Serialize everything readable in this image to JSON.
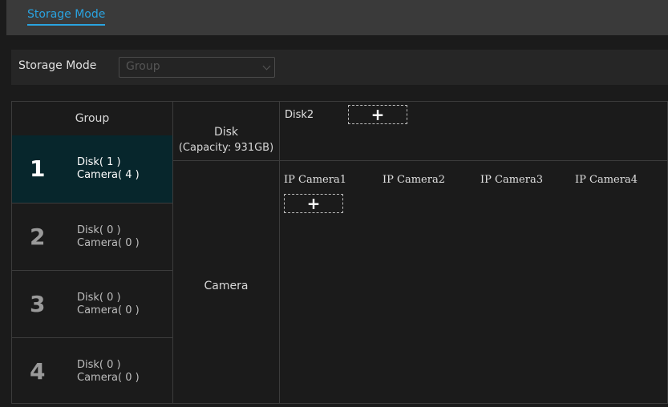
{
  "header": {
    "tab_title": "Storage Mode"
  },
  "mode": {
    "label": "Storage Mode",
    "selected": "Group"
  },
  "groups": {
    "header": "Group",
    "items": [
      {
        "num": "1",
        "disk": "Disk( 1 )",
        "camera": "Camera( 4 )",
        "active": true
      },
      {
        "num": "2",
        "disk": "Disk( 0 )",
        "camera": "Camera( 0 )",
        "active": false
      },
      {
        "num": "3",
        "disk": "Disk( 0 )",
        "camera": "Camera( 0 )",
        "active": false
      },
      {
        "num": "4",
        "disk": "Disk( 0 )",
        "camera": "Camera( 0 )",
        "active": false
      }
    ]
  },
  "disk_section": {
    "label": "Disk",
    "capacity": "(Capacity: 931GB)",
    "disks": [
      "Disk2"
    ],
    "add_symbol": "+"
  },
  "camera_section": {
    "label": "Camera",
    "cameras": [
      "IP Camera1",
      "IP Camera2",
      "IP Camera3",
      "IP Camera4"
    ],
    "add_symbol": "+"
  },
  "colors": {
    "accent": "#2aa3e0",
    "active_row": "#07262c",
    "background": "#1b1b1b"
  }
}
